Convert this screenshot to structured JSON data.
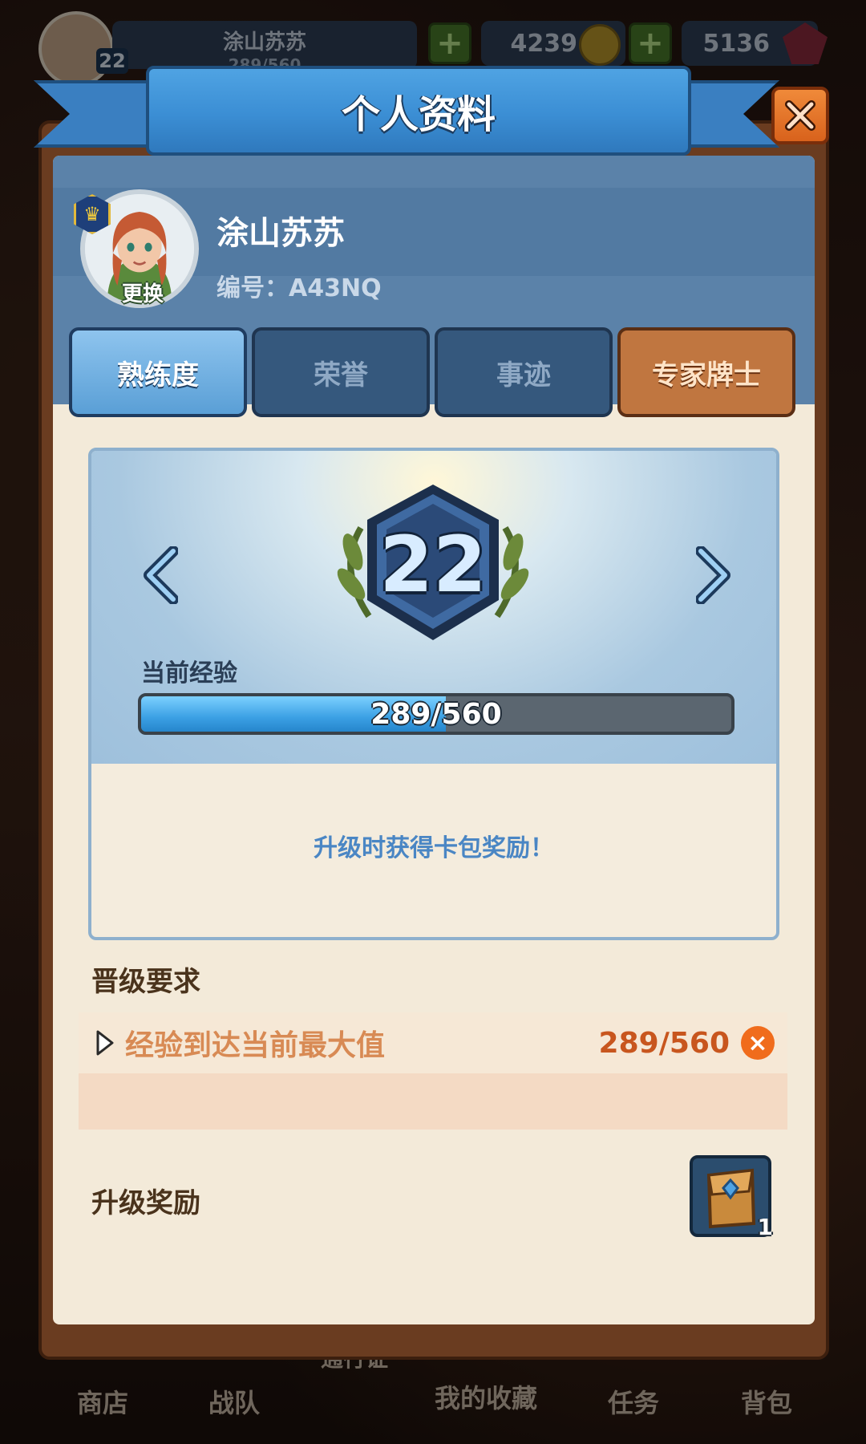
{
  "hud": {
    "player_name": "涂山苏苏",
    "exp": "289/560",
    "level": "22",
    "coins": "4239",
    "gems": "5136"
  },
  "bottom_nav": {
    "items": [
      "商店",
      "战队",
      "我的收藏",
      "任务",
      "背包"
    ],
    "partial_label": "通行证"
  },
  "panel": {
    "title": "个人资料",
    "close_icon": "close-icon"
  },
  "profile": {
    "name": "涂山苏苏",
    "id_label": "编号：A43NQ",
    "change_label": "更换",
    "badge_icon": "crown-icon"
  },
  "tabs": [
    {
      "label": "熟练度",
      "state": "active"
    },
    {
      "label": "荣誉",
      "state": "inactive"
    },
    {
      "label": "事迹",
      "state": "inactive"
    },
    {
      "label": "专家牌士",
      "state": "special"
    }
  ],
  "level_card": {
    "level": "22",
    "exp_label": "当前经验",
    "exp_text": "289/560",
    "exp_fraction": 0.516,
    "reward_note": "升级时获得卡包奖励！"
  },
  "requirements": {
    "title": "晋级要求",
    "items": [
      {
        "text": "经验到达当前最大值",
        "value": "289/560",
        "status_icon": "x-circle-icon"
      }
    ]
  },
  "rewards": {
    "title": "升级奖励",
    "items": [
      {
        "icon": "card-pack-icon",
        "count": "1"
      }
    ]
  },
  "colors": {
    "accent_blue": "#3b8ed4",
    "close_orange": "#e0701f",
    "requirement_orange": "#c8561e"
  }
}
